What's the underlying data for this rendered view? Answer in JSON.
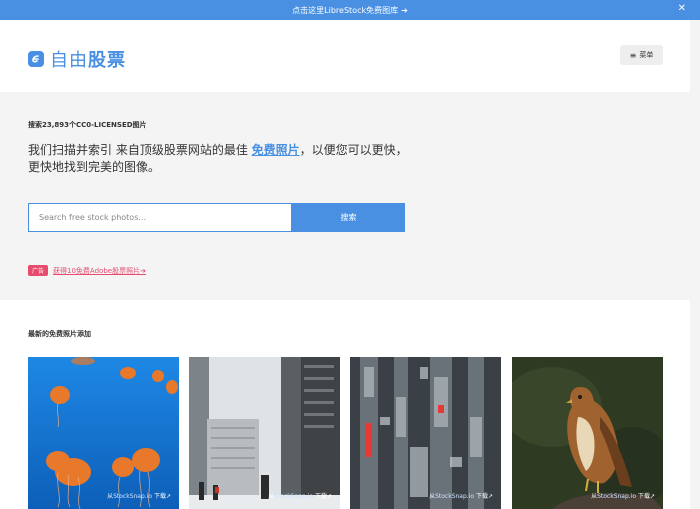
{
  "banner": {
    "text": "点击这里LibreStock免费图库",
    "arrow": "➔",
    "close": "✕"
  },
  "header": {
    "logo_text_a": "自由",
    "logo_text_b": "股票",
    "menu_icon": "≡",
    "menu_label": "菜单"
  },
  "hero": {
    "count_text": "搜索23,893个CC0-LICENSED图片",
    "desc_before": "我们扫描并索引 来自顶级股票网站的最佳 ",
    "desc_link": "免费照片",
    "desc_after": "，以便您可以更快，更快地找到完美的图像。",
    "search_placeholder": "Search free stock photos...",
    "search_button": "搜索",
    "promo_badge": "广告",
    "promo_link": "获得10免费Adobe股票照片➔"
  },
  "latest": {
    "title": "最新的免费照片添加",
    "photos": [
      {
        "caption_prefix": "从",
        "source": "StockSnap.io",
        "download": "下载↗",
        "subject": "jellyfish"
      },
      {
        "caption_prefix": "从",
        "source": "StockSnap.io",
        "download": "下载↗",
        "subject": "city-street"
      },
      {
        "caption_prefix": "从",
        "source": "StockSnap.io",
        "download": "下载↗",
        "subject": "aerial-city"
      },
      {
        "caption_prefix": "从",
        "source": "StockSnap.io",
        "download": "下载↗",
        "subject": "hawk"
      }
    ]
  },
  "colors": {
    "accent": "#4a90e2",
    "promo": "#e74c6f",
    "hero_bg": "#f4f4f4"
  }
}
